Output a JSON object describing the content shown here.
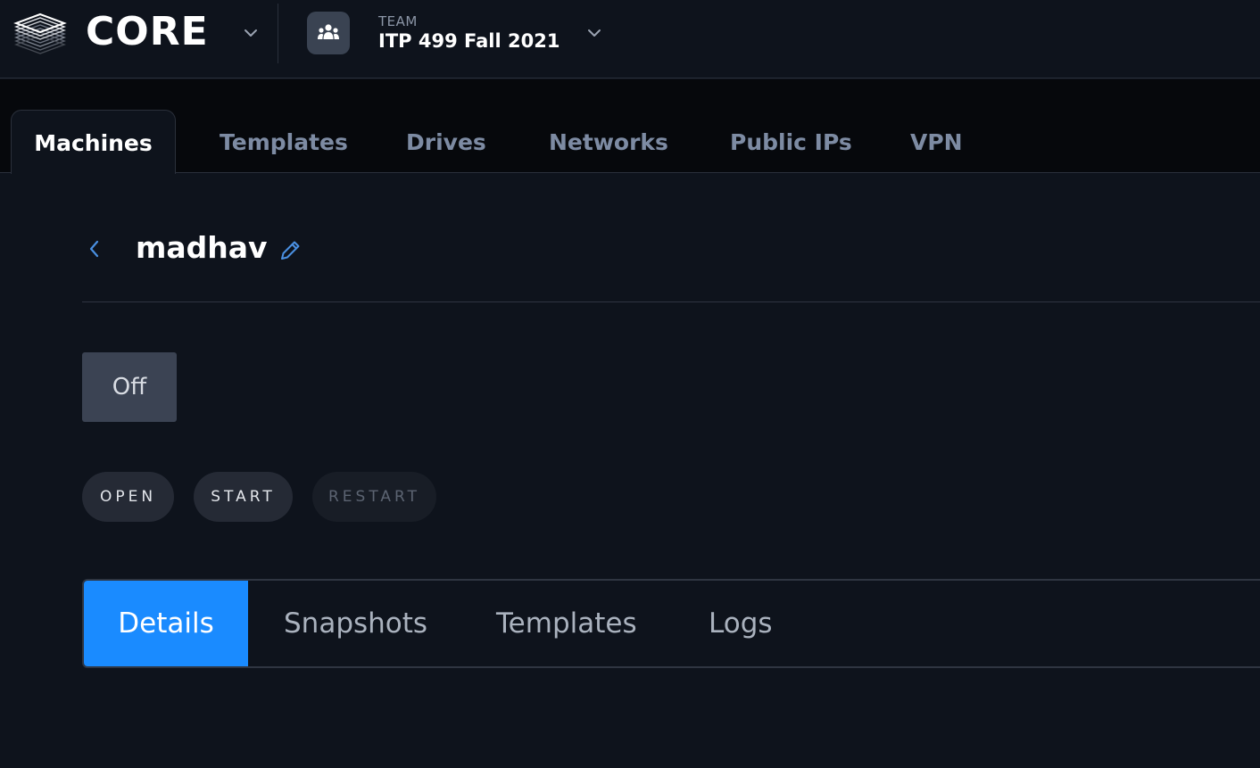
{
  "app": {
    "logo_text": "CORE",
    "logo_icon": "layers-icon"
  },
  "team": {
    "label": "TEAM",
    "name": "ITP 499 Fall 2021",
    "icon": "users-icon"
  },
  "nav_tabs": [
    {
      "label": "Machines",
      "active": true
    },
    {
      "label": "Templates",
      "active": false
    },
    {
      "label": "Drives",
      "active": false
    },
    {
      "label": "Networks",
      "active": false
    },
    {
      "label": "Public IPs",
      "active": false
    },
    {
      "label": "VPN",
      "active": false
    }
  ],
  "machine": {
    "name": "madhav",
    "status": "Off"
  },
  "actions": {
    "open": "OPEN",
    "start": "START",
    "restart": "RESTART"
  },
  "sub_tabs": [
    {
      "label": "Details",
      "active": true
    },
    {
      "label": "Snapshots",
      "active": false
    },
    {
      "label": "Templates",
      "active": false
    },
    {
      "label": "Logs",
      "active": false
    }
  ],
  "colors": {
    "background": "#0e131c",
    "accent": "#1a8bff",
    "nav_inactive": "#7d8ba3",
    "icon_blue": "#4a90e2"
  }
}
